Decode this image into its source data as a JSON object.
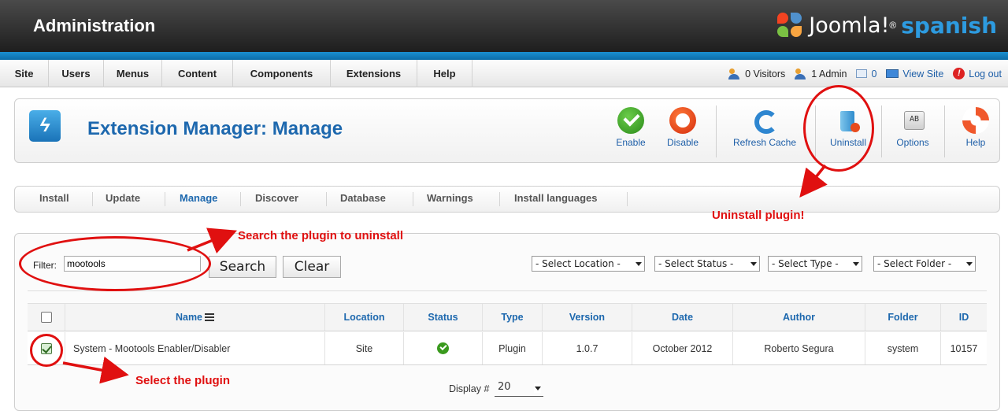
{
  "header": {
    "title": "Administration",
    "brand_joomla": "Joomla!",
    "brand_reg": "®",
    "brand_language": "spanish"
  },
  "menu": {
    "items": [
      "Site",
      "Users",
      "Menus",
      "Content",
      "Components",
      "Extensions",
      "Help"
    ]
  },
  "status": {
    "visitors": "0 Visitors",
    "admins": "1 Admin",
    "messages": "0",
    "view_site": "View Site",
    "logout": "Log out"
  },
  "toolbar": {
    "page_title": "Extension Manager: Manage",
    "enable": "Enable",
    "disable": "Disable",
    "refresh_cache": "Refresh Cache",
    "uninstall": "Uninstall",
    "options": "Options",
    "help": "Help"
  },
  "tabs": [
    "Install",
    "Update",
    "Manage",
    "Discover",
    "Database",
    "Warnings",
    "Install languages"
  ],
  "active_tab": "Manage",
  "filter": {
    "label": "Filter:",
    "value": "mootools",
    "search_button": "Search",
    "clear_button": "Clear",
    "select_location": "- Select Location -",
    "select_status": "- Select Status -",
    "select_type": "- Select Type -",
    "select_folder": "- Select Folder -"
  },
  "table": {
    "columns": [
      "Name",
      "Location",
      "Status",
      "Type",
      "Version",
      "Date",
      "Author",
      "Folder",
      "ID"
    ],
    "rows": [
      {
        "name": "System - Mootools Enabler/Disabler",
        "location": "Site",
        "status": "enabled",
        "type": "Plugin",
        "version": "1.0.7",
        "date": "October 2012",
        "author": "Roberto Segura",
        "folder": "system",
        "id": "10157",
        "checked": true
      }
    ],
    "display_label": "Display #",
    "display_value": "20"
  },
  "annotations": {
    "search_note": "Search the plugin to uninstall",
    "uninstall_note": "Uninstall plugin!",
    "select_note": "Select the plugin",
    "color": "#e01010"
  },
  "colors": {
    "accent_blue": "#1d68ae",
    "header_dark": "#2a2a2a",
    "bar_blue": "#1a8fd0"
  }
}
